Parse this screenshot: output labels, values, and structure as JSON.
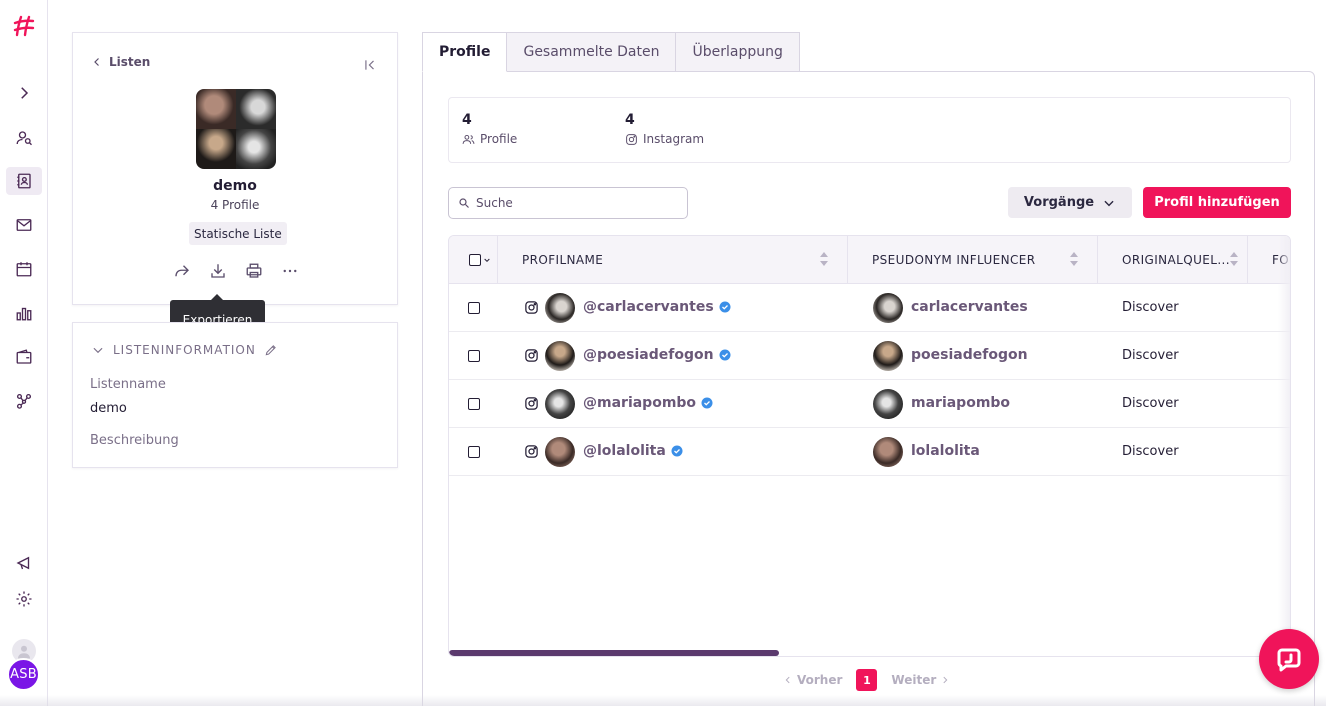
{
  "nav": {
    "items": [
      {
        "name": "expand",
        "active": false
      },
      {
        "name": "profiles-search",
        "active": false
      },
      {
        "name": "lists",
        "active": true
      },
      {
        "name": "mail",
        "active": false
      },
      {
        "name": "calendar",
        "active": false
      },
      {
        "name": "reports",
        "active": false
      },
      {
        "name": "wallet",
        "active": false
      },
      {
        "name": "network",
        "active": false
      },
      {
        "name": "announcements",
        "active": false
      },
      {
        "name": "settings",
        "active": false
      }
    ],
    "user_initials": "ASB"
  },
  "list_card": {
    "back_label": "Listen",
    "name": "demo",
    "count": "4 Profile",
    "type": "Statische Liste",
    "actions": [
      "share-icon",
      "download-icon",
      "print-icon",
      "more-icon"
    ],
    "tooltip": "Exportieren"
  },
  "info_card": {
    "header": "LISTENINFORMATION",
    "name_label": "Listenname",
    "name_value": "demo",
    "description_label": "Beschreibung"
  },
  "tabs": [
    {
      "label": "Profile",
      "active": true
    },
    {
      "label": "Gesammelte Daten",
      "active": false
    },
    {
      "label": "Überlappung",
      "active": false
    }
  ],
  "stats": {
    "profiles": {
      "value": "4",
      "label": "Profile"
    },
    "instagram": {
      "value": "4",
      "label": "Instagram"
    }
  },
  "search": {
    "placeholder": "Suche",
    "value": ""
  },
  "toolbar": {
    "operations_label": "Vorgänge",
    "add_label": "Profil hinzufügen"
  },
  "table": {
    "columns": [
      "PROFILNAME",
      "PSEUDONYM INFLUENCER",
      "ORIGINALQUEL...",
      "FOI"
    ],
    "rows": [
      {
        "handle": "@carlacervantes",
        "pseudonym": "carlacervantes",
        "source": "Discover",
        "verified": true
      },
      {
        "handle": "@poesiadefogon",
        "pseudonym": "poesiadefogon",
        "source": "Discover",
        "verified": true
      },
      {
        "handle": "@mariapombo",
        "pseudonym": "mariapombo",
        "source": "Discover",
        "verified": true
      },
      {
        "handle": "@lolalolita",
        "pseudonym": "lolalolita",
        "source": "Discover",
        "verified": true
      }
    ]
  },
  "pagination": {
    "prev": "Vorher",
    "current": "1",
    "next": "Weiter"
  },
  "colors": {
    "brand": "#f0145a",
    "accent": "#5b3a6e",
    "avatar": "#7a16e6",
    "verified": "#3b8fe8"
  }
}
